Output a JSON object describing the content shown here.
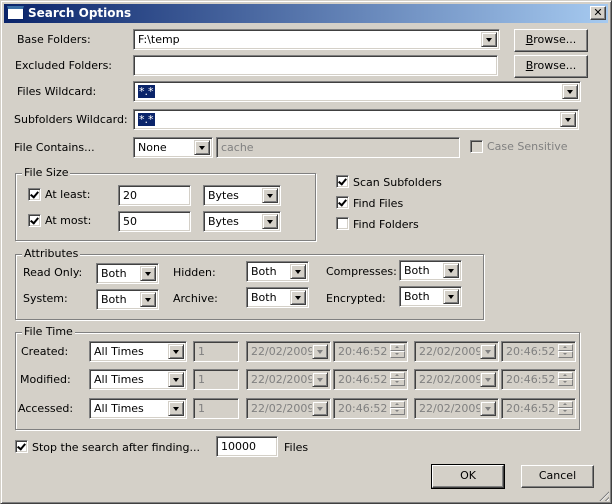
{
  "window": {
    "title": "Search Options",
    "close_icon": "close-icon"
  },
  "base_folders": {
    "label": "Base Folders:",
    "value": "F:\\temp",
    "browse_label": "Browse...",
    "browse_accel": "B",
    "browse_rest": "rowse..."
  },
  "excluded_folders": {
    "label": "Excluded Folders:",
    "value": "",
    "browse_label": "Browse...",
    "browse_accel": "B",
    "browse_rest": "rowse..."
  },
  "files_wildcard": {
    "label": "Files Wildcard:",
    "value": "*.*"
  },
  "subfolders_wildcard": {
    "label": "Subfolders Wildcard:",
    "value": "*.*"
  },
  "file_contains": {
    "label": "File Contains...",
    "mode": "None",
    "text": "cache",
    "case_sensitive_label": "Case Sensitive",
    "case_sensitive": false
  },
  "file_size": {
    "title": "File Size",
    "at_least": {
      "label": "At least:",
      "checked": true,
      "value": "20",
      "unit": "Bytes"
    },
    "at_most": {
      "label": "At most:",
      "checked": true,
      "value": "50",
      "unit": "Bytes"
    }
  },
  "options": {
    "scan_subfolders": {
      "label": "Scan Subfolders",
      "checked": true
    },
    "find_files": {
      "label": "Find Files",
      "checked": true
    },
    "find_folders": {
      "label": "Find Folders",
      "checked": false
    }
  },
  "attributes": {
    "title": "Attributes",
    "read_only": {
      "label": "Read Only:",
      "value": "Both"
    },
    "hidden": {
      "label": "Hidden:",
      "value": "Both"
    },
    "compresses": {
      "label": "Compresses:",
      "value": "Both"
    },
    "system": {
      "label": "System:",
      "value": "Both"
    },
    "archive": {
      "label": "Archive:",
      "value": "Both"
    },
    "encrypted": {
      "label": "Encrypted:",
      "value": "Both"
    }
  },
  "file_time": {
    "title": "File Time",
    "rows": [
      {
        "label": "Created:",
        "mode": "All Times",
        "count": "1",
        "from_date": "22/02/2009",
        "from_time": "20:46:52",
        "to_date": "22/02/2009",
        "to_time": "20:46:52"
      },
      {
        "label": "Modified:",
        "mode": "All Times",
        "count": "1",
        "from_date": "22/02/2009",
        "from_time": "20:46:52",
        "to_date": "22/02/2009",
        "to_time": "20:46:52"
      },
      {
        "label": "Accessed:",
        "mode": "All Times",
        "count": "1",
        "from_date": "22/02/2009",
        "from_time": "20:46:52",
        "to_date": "22/02/2009",
        "to_time": "20:46:52"
      }
    ]
  },
  "stop_search": {
    "label": "Stop the search after finding...",
    "checked": true,
    "value": "10000",
    "unit": "Files"
  },
  "buttons": {
    "ok": "OK",
    "cancel": "Cancel"
  }
}
